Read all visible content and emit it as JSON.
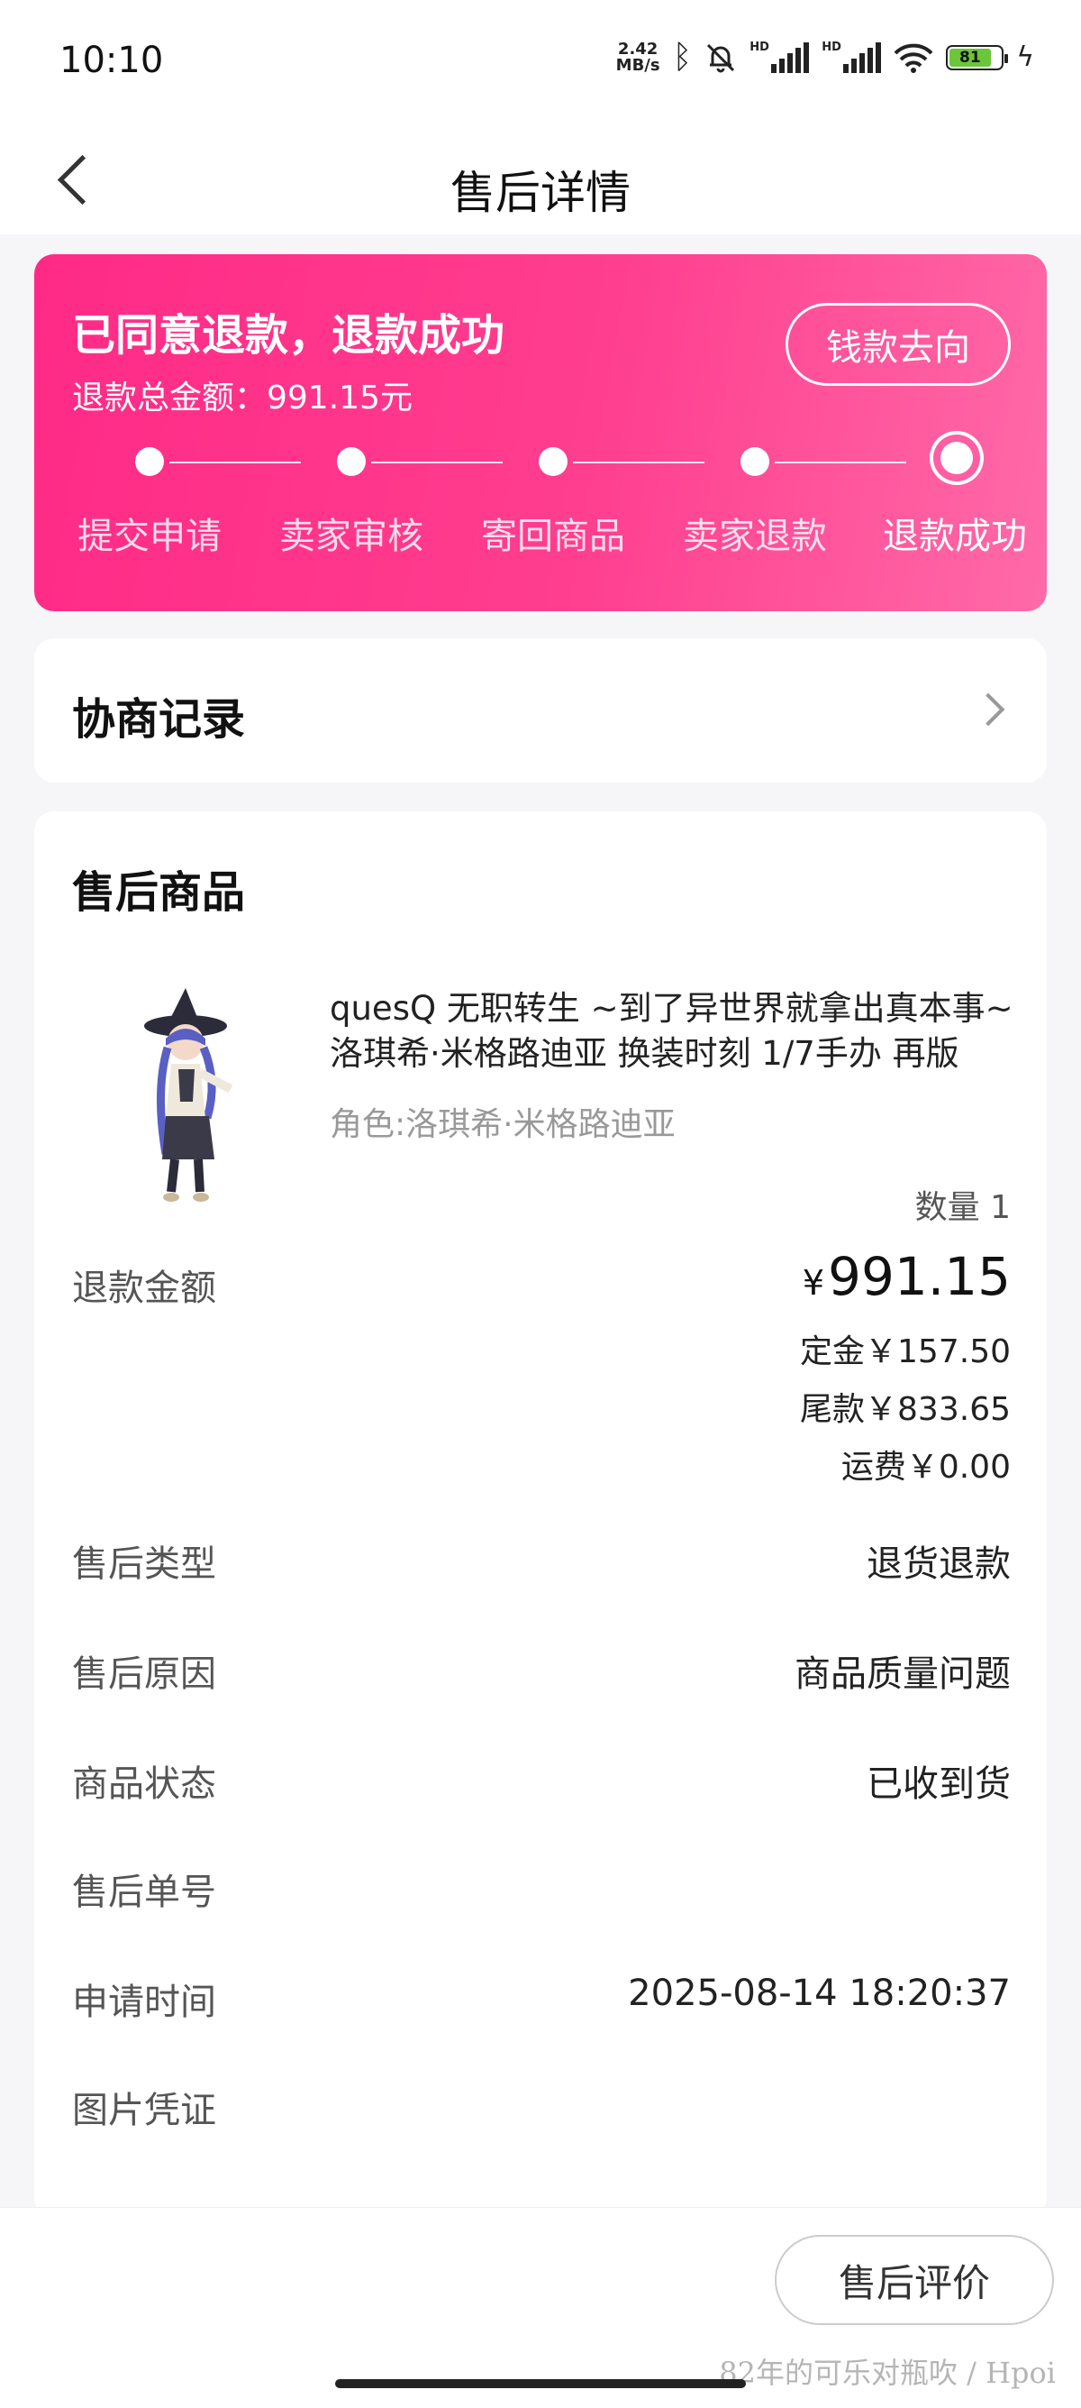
{
  "status_bar": {
    "time": "10:10",
    "net_speed_value": "2.42",
    "net_speed_unit": "MB/s",
    "signal_tag": "HD",
    "battery": "81"
  },
  "nav": {
    "title": "售后详情"
  },
  "status_card": {
    "title": "已同意退款，退款成功",
    "refund_total": "退款总金额：991.15元",
    "money_button": "钱款去向",
    "steps": [
      "提交申请",
      "卖家审核",
      "寄回商品",
      "卖家退款",
      "退款成功"
    ],
    "current_step": 4
  },
  "negotiation": {
    "title": "协商记录"
  },
  "product": {
    "section_title": "售后商品",
    "name": "quesQ 无职转生 ~到了异世界就拿出真本事~ 洛琪希·米格路迪亚 换装时刻 1/7手办 再版",
    "spec": "角色:洛琪希·米格路迪亚",
    "quantity": "数量 1"
  },
  "details": {
    "refund_amount_label": "退款金额",
    "currency_symbol": "¥",
    "refund_amount": "991.15",
    "deposit": "定金￥157.50",
    "balance": "尾款￥833.65",
    "shipping": "运费￥0.00",
    "type_label": "售后类型",
    "type_value": "退货退款",
    "reason_label": "售后原因",
    "reason_value": "商品质量问题",
    "goods_status_label": "商品状态",
    "goods_status_value": "已收到货",
    "order_no_label": "售后单号",
    "order_no_value": "",
    "apply_time_label": "申请时间",
    "apply_time_value": "2025-08-14 18:20:37",
    "evidence_label": "图片凭证"
  },
  "bottom": {
    "review_button": "售后评价",
    "watermark": "82年的可乐对瓶吹 / Hpoi"
  },
  "colors": {
    "accent": "#ff2a86",
    "accent_light": "#ff6aa8"
  }
}
